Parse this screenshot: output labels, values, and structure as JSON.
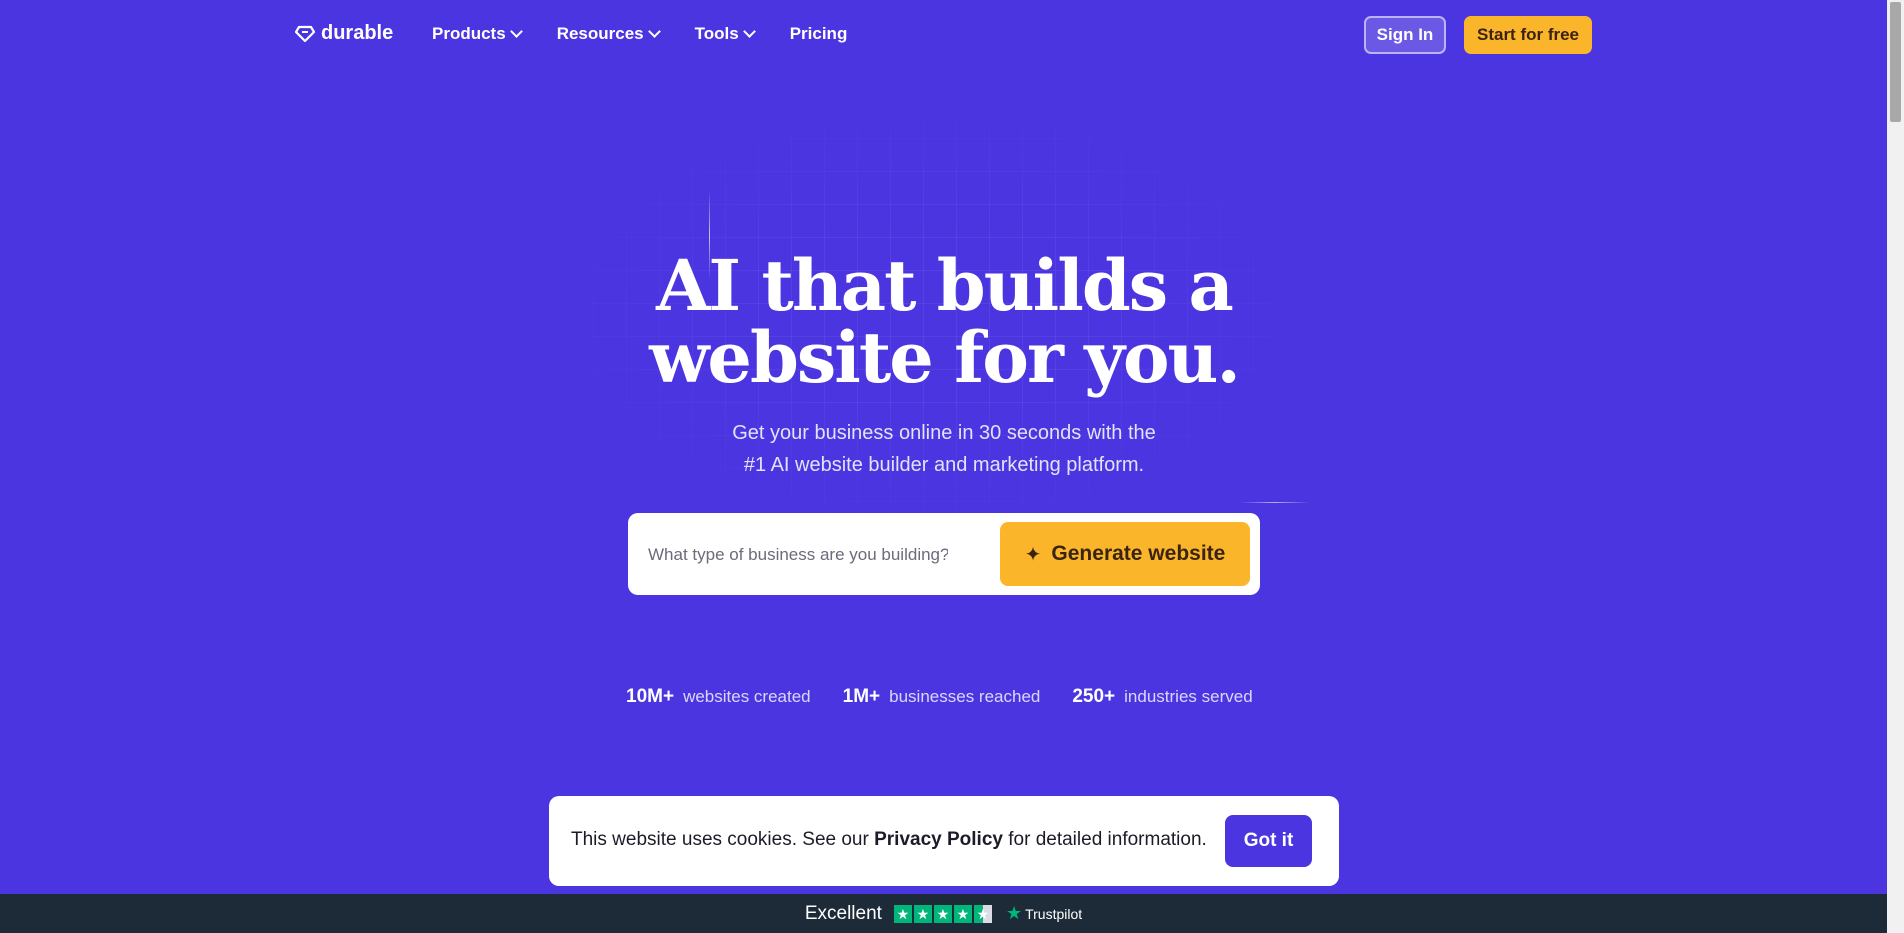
{
  "header": {
    "logo_text": "durable",
    "nav": [
      {
        "label": "Products",
        "has_dropdown": true
      },
      {
        "label": "Resources",
        "has_dropdown": true
      },
      {
        "label": "Tools",
        "has_dropdown": true
      },
      {
        "label": "Pricing",
        "has_dropdown": false
      }
    ],
    "signin_label": "Sign In",
    "start_label": "Start for free"
  },
  "hero": {
    "title_line1": "AI that builds a",
    "title_line2": "website for you.",
    "subtitle_line1": "Get your business online in 30 seconds with the",
    "subtitle_line2": "#1 AI website builder and marketing platform.",
    "search_placeholder": "What type of business are you building?",
    "generate_label": "Generate website"
  },
  "stats": [
    {
      "value": "10M+",
      "label": "websites created"
    },
    {
      "value": "1M+",
      "label": "businesses reached"
    },
    {
      "value": "250+",
      "label": "industries served"
    }
  ],
  "cookie": {
    "text_before": "This website uses cookies. See our",
    "link": "Privacy Policy",
    "text_after": "for detailed information.",
    "button": "Got it"
  },
  "trustpilot": {
    "rating_label": "Excellent",
    "stars": 4.5,
    "brand": "Trustpilot"
  },
  "colors": {
    "background": "#4b35e1",
    "accent": "#fbb52a",
    "trust_green": "#00b67a",
    "footer_bar": "#1d2a38"
  }
}
